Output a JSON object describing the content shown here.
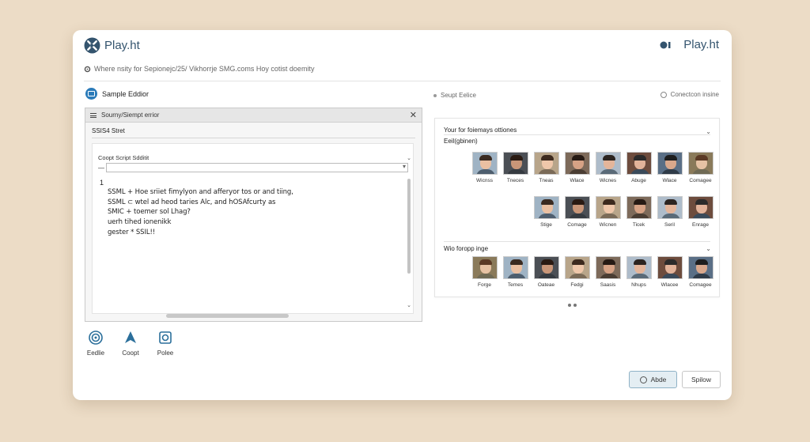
{
  "header": {
    "brand": "Play.ht",
    "brand_right": "Play.ht",
    "subheader": "Where nsity for Sepionejc/25/ Vikhorrje   SMG.coms Hoy cotist doemity"
  },
  "section": {
    "title": "Sample Eddior",
    "mid_label": "Seupt Eelice",
    "right_label": "Conectcon insine"
  },
  "editor": {
    "title": "Sourny/Siempt errior",
    "subtitle": "SSIS4 Stret",
    "script_label": "Coopt Script Sdditit",
    "script_prefix": "—",
    "line_number": "1",
    "lines": [
      "SSML + Hoe sriiet fimylyon and afferyor tos or and tiing,",
      "SSML ⊂ wtel ad heod taries Alc, and hOSAfcurty as",
      "SMIC + toemer sol Lhag?",
      "uerh tihed ionenikk",
      "gester * SSIL!!"
    ]
  },
  "tools": [
    {
      "label": "Eedlie",
      "icon": "target-icon"
    },
    {
      "label": "Coopt",
      "icon": "compass-icon"
    },
    {
      "label": "Polee",
      "icon": "square-icon"
    }
  ],
  "voices": {
    "title": "Your for foiemays ottiones",
    "subtitle": "Eeil(gbinen)",
    "group1_row1": [
      "Wicnss",
      "Tneces",
      "Tneas",
      "Wlace",
      "Wicnes",
      "Abuge",
      "Wlace",
      "Comagee"
    ],
    "group1_row2": [
      "Stige",
      "Comage",
      "Wicnen",
      "Ticek",
      "Seril",
      "Enrage"
    ],
    "group2_title": "Wio foropp inge",
    "group2_row": [
      "Forge",
      "Temes",
      "Oateae",
      "Fedgi",
      "Saasis",
      "Nhups",
      "Wlacee",
      "Comagee"
    ]
  },
  "buttons": {
    "apply": "Abde",
    "save": "Spilow"
  },
  "colors": {
    "accent": "#2b7bb9",
    "background": "#ecdcc6"
  }
}
